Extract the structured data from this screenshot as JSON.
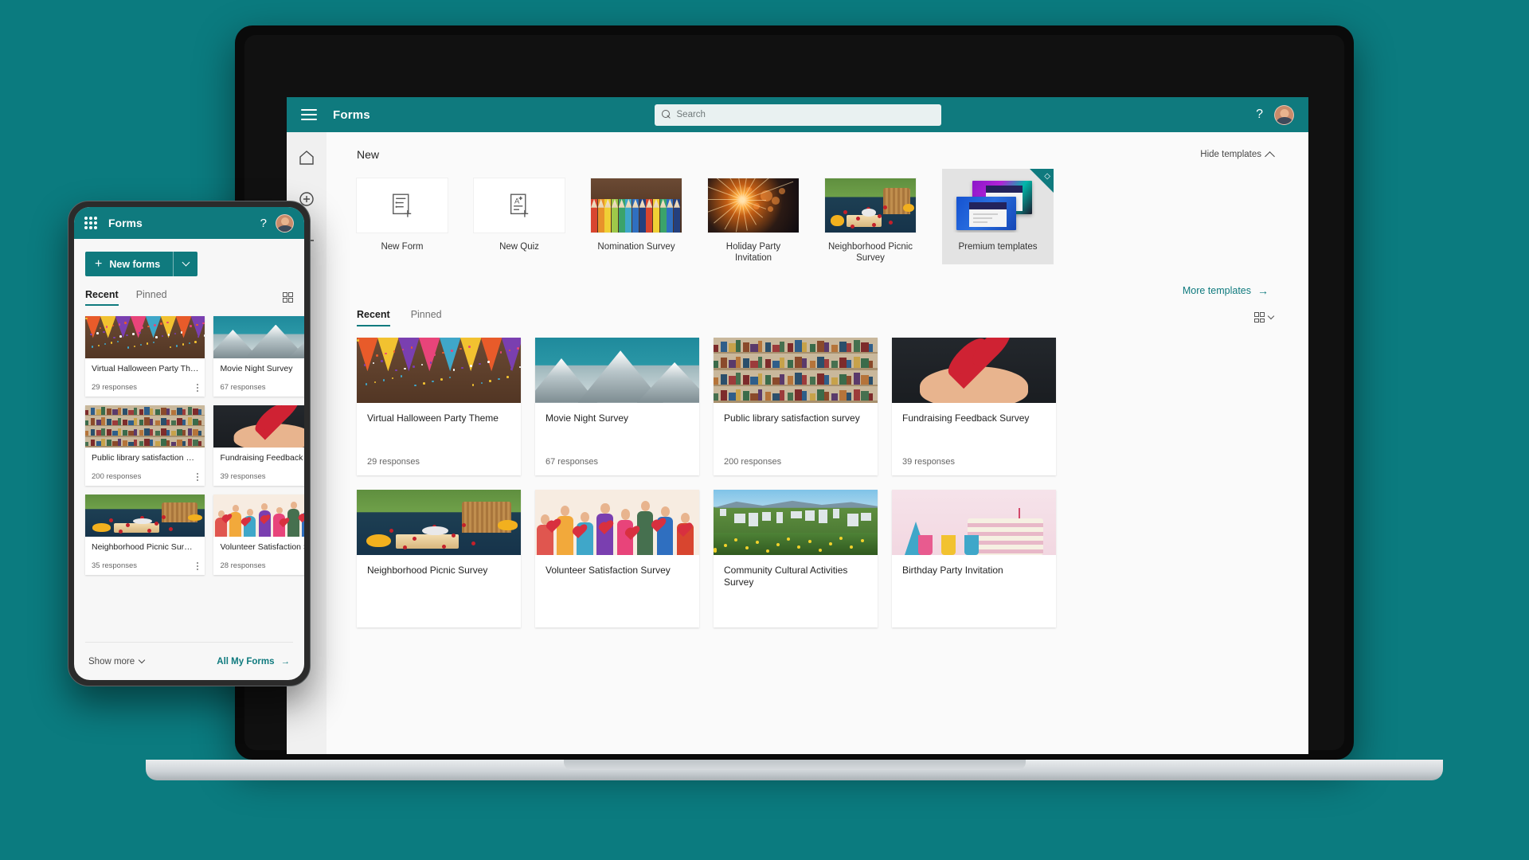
{
  "brand_color": "#0f7a7e",
  "desktop": {
    "header": {
      "app_title": "Forms",
      "search_placeholder": "Search",
      "search_value": "",
      "help_label": "?",
      "menu_icon": "hamburger-icon",
      "avatar_icon": "user-avatar"
    },
    "rail": [
      {
        "name": "home",
        "icon": "home-icon"
      },
      {
        "name": "create",
        "icon": "plus-circle-icon"
      },
      {
        "name": "analytics",
        "icon": "pulse-icon"
      }
    ],
    "new_section": {
      "title": "New",
      "hide_templates_label": "Hide templates",
      "more_templates_label": "More templates",
      "templates": [
        {
          "label": "New Form",
          "art": "icon-form"
        },
        {
          "label": "New Quiz",
          "art": "icon-quiz"
        },
        {
          "label": "Nomination Survey",
          "art": "pencils"
        },
        {
          "label": "Holiday Party Invitation",
          "art": "sparkler"
        },
        {
          "label": "Neighborhood Picnic Survey",
          "art": "picnic"
        }
      ],
      "premium": {
        "label": "Premium templates",
        "badge_icon": "diamond-icon"
      }
    },
    "tabs": [
      {
        "label": "Recent",
        "active": true
      },
      {
        "label": "Pinned",
        "active": false
      }
    ],
    "view_toggle": {
      "icon": "grid-view-icon",
      "caret": "chevron-down-icon"
    },
    "cards": [
      {
        "title": "Virtual Halloween Party Theme",
        "responses": "29 responses",
        "art": "halloween"
      },
      {
        "title": "Movie Night Survey",
        "responses": "67 responses",
        "art": "mountains"
      },
      {
        "title": "Public library satisfaction survey",
        "responses": "200 responses",
        "art": "library"
      },
      {
        "title": "Fundraising Feedback Survey",
        "responses": "39 responses",
        "art": "heart"
      },
      {
        "title": "Neighborhood Picnic Survey",
        "responses": "",
        "art": "picnic"
      },
      {
        "title": "Volunteer Satisfaction Survey",
        "responses": "",
        "art": "volunteers"
      },
      {
        "title": "Community Cultural Activities Survey",
        "responses": "",
        "art": "city"
      },
      {
        "title": "Birthday Party Invitation",
        "responses": "",
        "art": "birthday"
      }
    ]
  },
  "mobile": {
    "header": {
      "app_title": "Forms",
      "waffle_icon": "app-launcher-icon",
      "help_label": "?",
      "avatar_icon": "user-avatar"
    },
    "new_forms_button": {
      "label": "New forms",
      "plus": "+",
      "caret_icon": "chevron-down-icon"
    },
    "tabs": [
      {
        "label": "Recent",
        "active": true
      },
      {
        "label": "Pinned",
        "active": false
      }
    ],
    "view_icon": "grid-view-icon",
    "cards": [
      {
        "title": "Virtual Halloween Party Th…",
        "responses": "29 responses",
        "art": "halloween"
      },
      {
        "title": "Movie Night Survey",
        "responses": "67 responses",
        "art": "mountains"
      },
      {
        "title": "Public library satisfaction …",
        "responses": "200 responses",
        "art": "library"
      },
      {
        "title": "Fundraising Feedback Sur…",
        "responses": "39 responses",
        "art": "heart"
      },
      {
        "title": "Neighborhood Picnic Sur…",
        "responses": "35 responses",
        "art": "picnic"
      },
      {
        "title": "Volunteer Satisfaction Sur…",
        "responses": "28 responses",
        "art": "volunteers"
      }
    ],
    "footer": {
      "show_more_label": "Show more",
      "all_forms_label": "All My Forms",
      "arrow_icon": "arrow-right-icon"
    }
  }
}
